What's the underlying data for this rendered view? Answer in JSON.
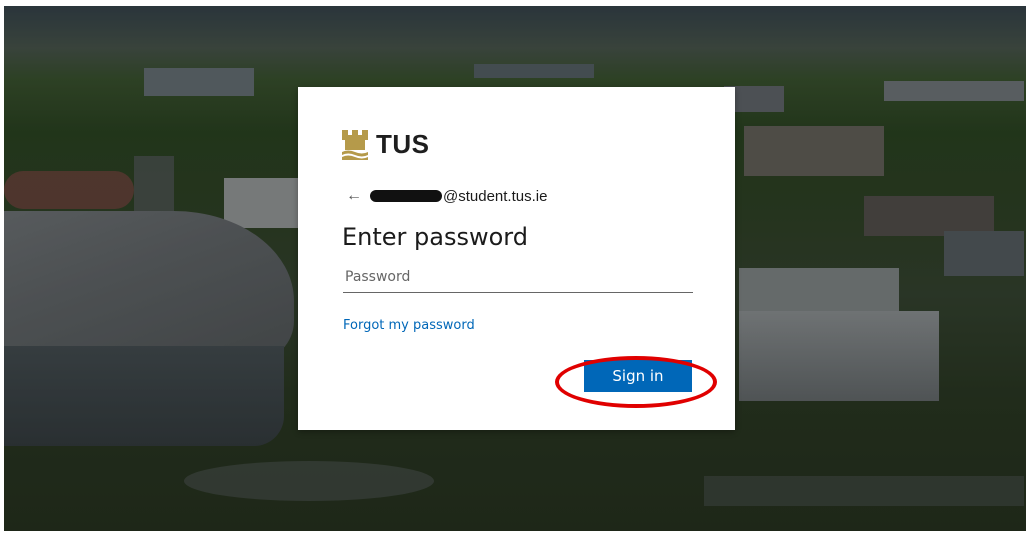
{
  "background": {
    "description_icon": "campus-aerial-photo"
  },
  "brand": {
    "logo_text": "TUS",
    "logo_icon": "tus-castle-logo-icon",
    "logo_color": "#b59a4a"
  },
  "identity": {
    "back_icon": "arrow-left-icon",
    "redacted_prefix": "",
    "email_suffix": "@student.tus.ie"
  },
  "form": {
    "heading": "Enter password",
    "password_placeholder": "Password",
    "password_value": "",
    "forgot_link": "Forgot my password",
    "submit_label": "Sign in"
  },
  "colors": {
    "accent": "#0067b8",
    "annotation": "#e00000"
  }
}
